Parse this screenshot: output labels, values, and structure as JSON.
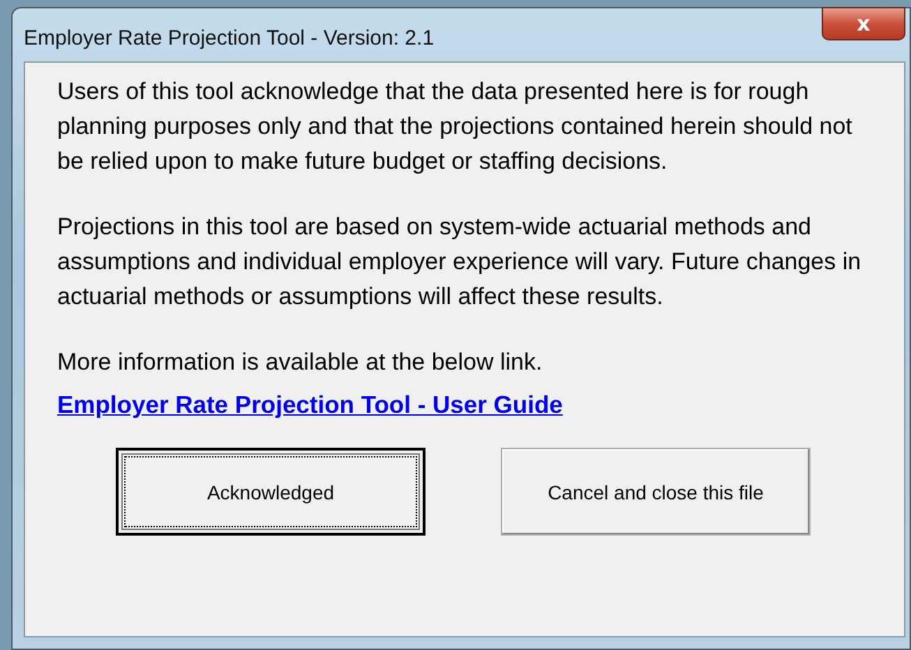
{
  "window": {
    "title": "Employer Rate Projection Tool - Version: 2.1",
    "close_button": "x"
  },
  "paragraphs": [
    "Users of this tool acknowledge that the data presented here is for rough planning purposes only and that the projections contained herein should not be relied upon to make future budget or staffing decisions.",
    "Projections in this tool are based on system-wide actuarial methods and assumptions and individual employer experience will vary. Future changes in actuarial methods or assumptions will affect these results.",
    "More information is available at the below link."
  ],
  "link": "Employer Rate Projection Tool - User Guide",
  "buttons": [
    {
      "label": "Acknowledged",
      "focused": true
    },
    {
      "label": "Cancel and close this file",
      "focused": false
    }
  ]
}
